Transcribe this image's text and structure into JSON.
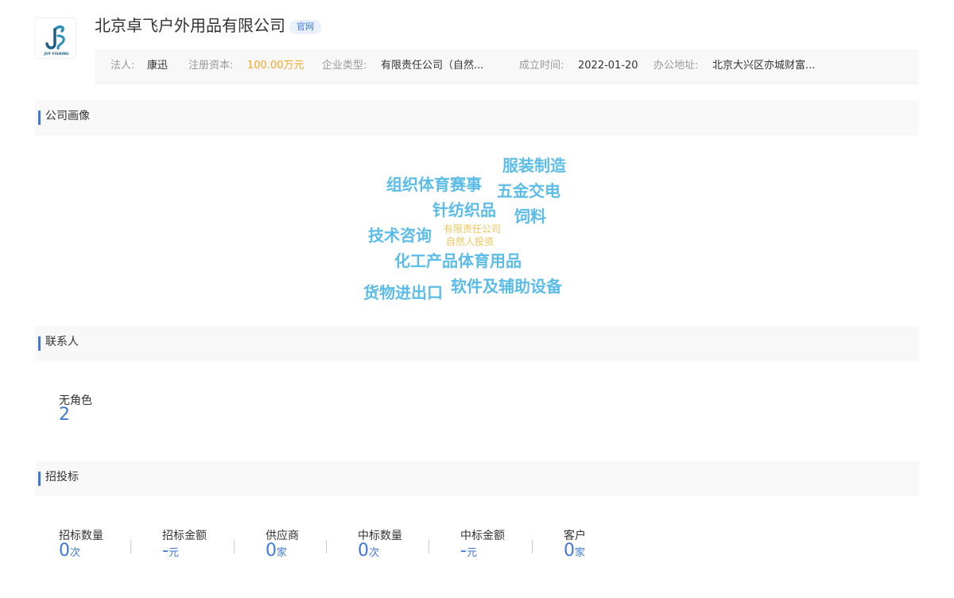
{
  "company": {
    "name": "北京卓飞户外用品有限公司",
    "official_badge": "官网",
    "logo_text": "JOY FISHING"
  },
  "info": {
    "legal_rep_label": "法人:",
    "legal_rep": "康迅",
    "capital_label": "注册资本:",
    "capital": "100.00万元",
    "type_label": "企业类型:",
    "type": "有限责任公司（自然...",
    "founded_label": "成立时间:",
    "founded": "2022-01-20",
    "address_label": "办公地址:",
    "address": "北京大兴区亦城财富..."
  },
  "profile": {
    "title": "公司画像",
    "words": [
      "服装制造",
      "组织体育赛事",
      "五金交电",
      "针纺织品",
      "饲料",
      "技术咨询",
      "有限责任公司",
      "自然人投资",
      "化工产品体育用品",
      "货物进出口",
      "软件及辅助设备"
    ]
  },
  "contacts": {
    "title": "联系人",
    "role_label": "无角色",
    "role_count": "2"
  },
  "bidding": {
    "title": "招投标",
    "stats": [
      {
        "label": "招标数量",
        "value": "0",
        "unit": "次"
      },
      {
        "label": "招标金额",
        "value": "-",
        "unit": "元"
      },
      {
        "label": "供应商",
        "value": "0",
        "unit": "家"
      },
      {
        "label": "中标数量",
        "value": "0",
        "unit": "次"
      },
      {
        "label": "中标金额",
        "value": "-",
        "unit": "元"
      },
      {
        "label": "客户",
        "value": "0",
        "unit": "家"
      }
    ]
  },
  "colors": {
    "accent": "#3f78d8",
    "word_cloud_blue": "#5bbce8",
    "word_cloud_yellow": "#f2c45a",
    "capital_orange": "#f5a623"
  }
}
